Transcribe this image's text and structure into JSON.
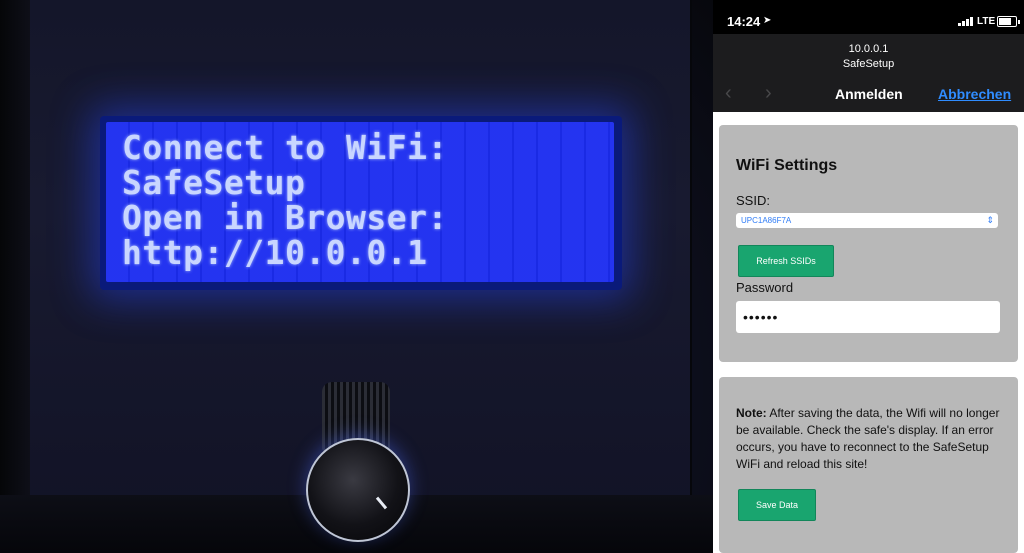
{
  "lcd": {
    "lines": [
      "Connect to WiFi:",
      "SafeSetup",
      "Open in Browser:",
      "http://10.0.0.1"
    ]
  },
  "status_bar": {
    "time": "14:24",
    "location_icon": "location-arrow-icon",
    "network": "LTE",
    "signal_icon": "cellular-signal-icon",
    "battery_icon": "battery-icon"
  },
  "browser": {
    "url": "10.0.0.1",
    "site_name": "SafeSetup",
    "back_icon": "chevron-left-icon",
    "forward_icon": "chevron-right-icon",
    "title": "Anmelden",
    "cancel_label": "Abbrechen",
    "link_color": "#2f8cff"
  },
  "wifi_settings": {
    "heading": "WiFi Settings",
    "ssid_label": "SSID:",
    "ssid_value": "UPC1A86F7A",
    "refresh_label": "Refresh SSIDs",
    "password_label": "Password",
    "password_value": "••••••"
  },
  "note": {
    "prefix": "Note:",
    "text": "After saving the data, the Wifi will no longer be available. Check the safe's display. If an error occurs, you have to reconnect to the SafeSetup WiFi and reload this site!",
    "save_label": "Save Data"
  },
  "colors": {
    "button_green": "#19a56f",
    "card_gray": "#b8b8b8",
    "lcd_blue": "#1b2cf0"
  }
}
